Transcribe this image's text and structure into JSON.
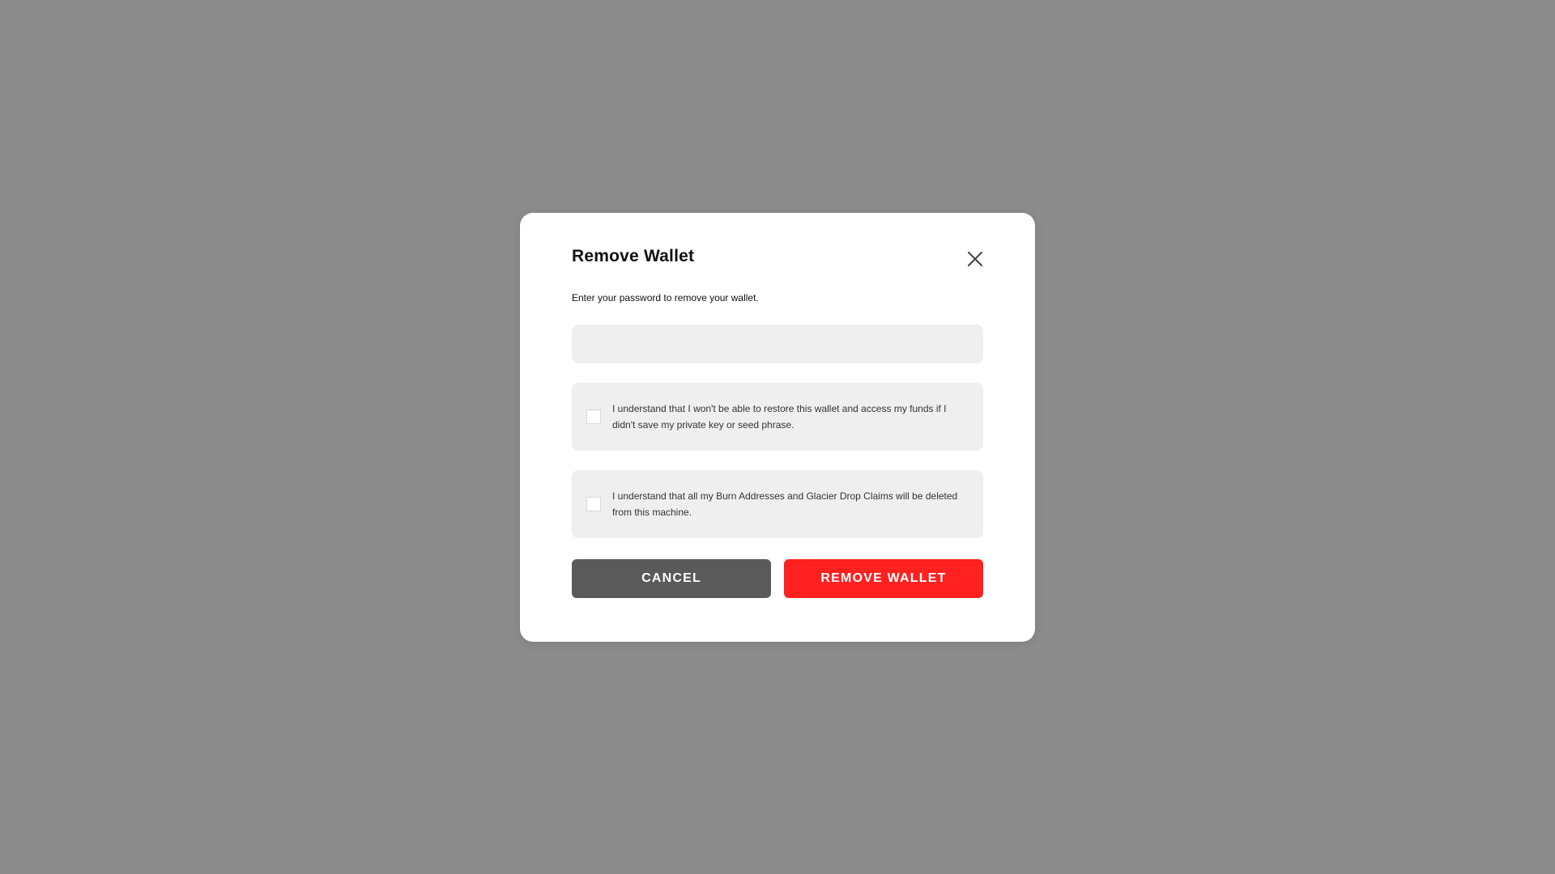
{
  "dialog": {
    "title": "Remove Wallet",
    "subtitle": "Enter your password to remove your wallet.",
    "password": {
      "value": "",
      "placeholder": ""
    },
    "confirmations": [
      {
        "text": "I understand that I won't be able to restore this wallet and access my funds if I didn't save my private key or seed phrase.",
        "checked": false
      },
      {
        "text": "I understand that all my Burn Addresses and Glacier Drop Claims will be deleted from this machine.",
        "checked": false
      }
    ],
    "cancel_label": "CANCEL",
    "remove_label": "REMOVE WALLET",
    "close_icon": "close-icon"
  },
  "colors": {
    "backdrop": "#8c8c8c",
    "dialog_bg": "#ffffff",
    "field_bg": "#efefef",
    "cancel_bg": "#5a5a5a",
    "danger": "#ff2020"
  }
}
